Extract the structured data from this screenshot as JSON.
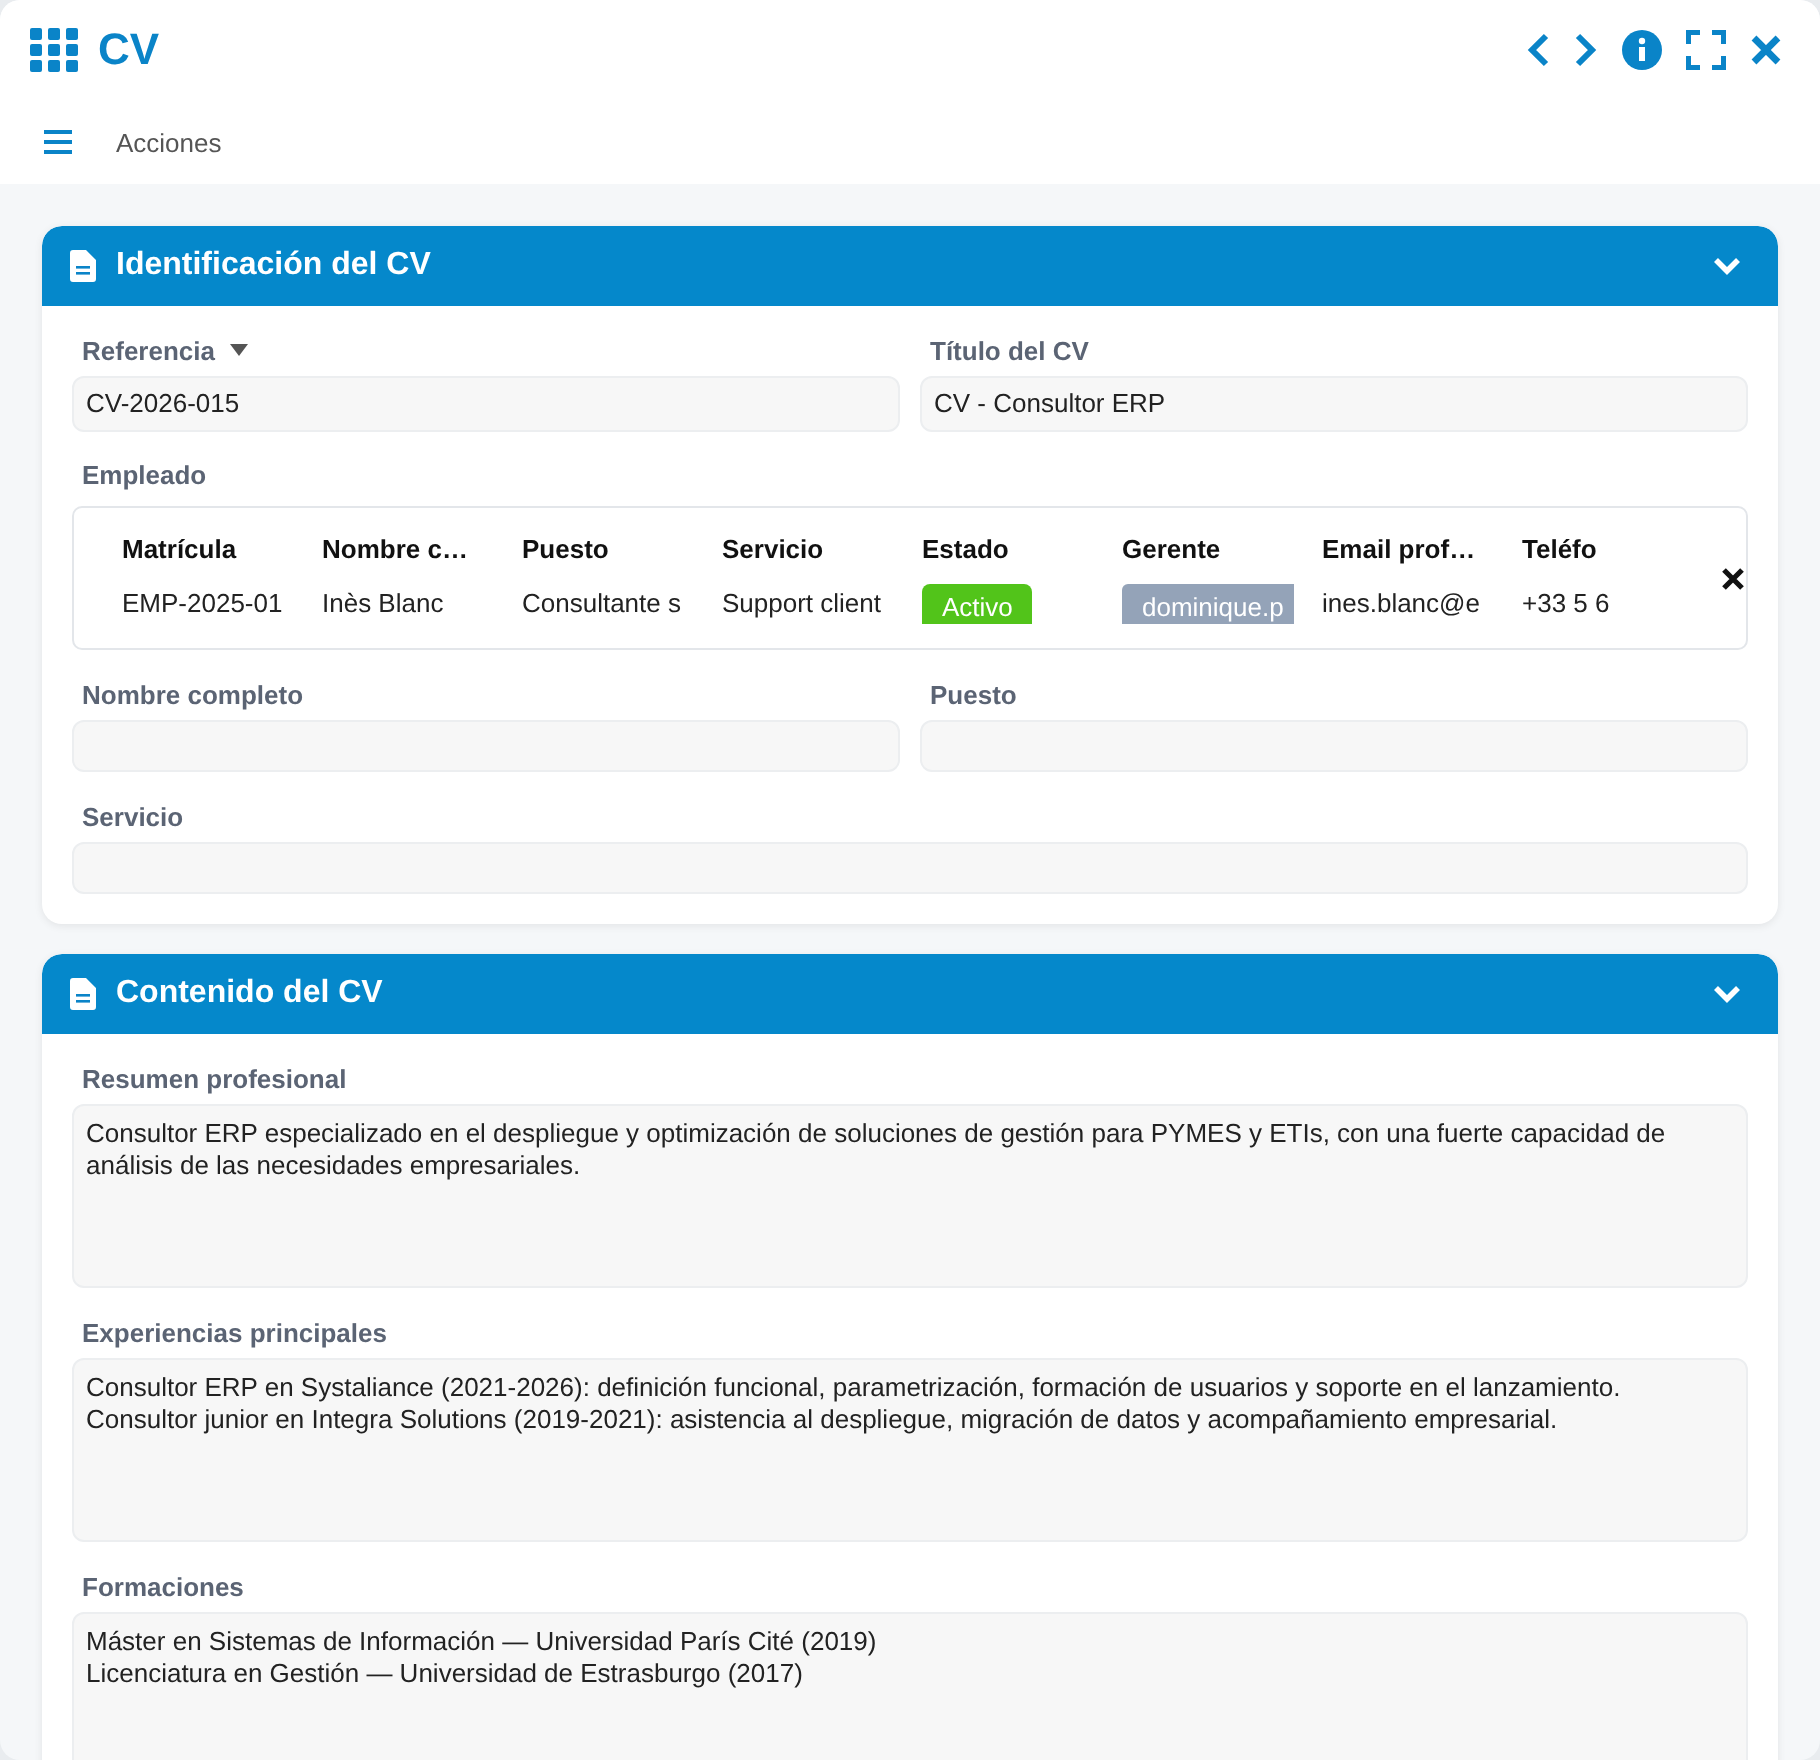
{
  "window": {
    "title": "CV"
  },
  "toolbar": {
    "actions_label": "Acciones"
  },
  "sections": [
    {
      "title": "Identificación del CV",
      "expanded": true,
      "kind": "identification",
      "fields_top": [
        {
          "label": "Referencia",
          "value": "CV-2026-015",
          "dropdown": true
        },
        {
          "label": "Título del CV",
          "value": "CV - Consultor ERP",
          "dropdown": false
        }
      ],
      "employee": {
        "label": "Empleado",
        "columns": [
          {
            "header": "Matrícula",
            "value": "EMP-2025-01",
            "kind": "text"
          },
          {
            "header": "Nombre c…",
            "value": "Inès Blanc",
            "kind": "text"
          },
          {
            "header": "Puesto",
            "value": "Consultante s",
            "kind": "text"
          },
          {
            "header": "Servicio",
            "value": "Support client",
            "kind": "text"
          },
          {
            "header": "Estado",
            "value": "Activo",
            "kind": "status",
            "color": "#52c41a"
          },
          {
            "header": "Gerente",
            "value": "dominique.p",
            "kind": "tag",
            "color": "#94a3b8"
          },
          {
            "header": "Email prof…",
            "value": "ines.blanc@e",
            "kind": "text"
          },
          {
            "header": "Teléfo",
            "value": "+33 5 6",
            "kind": "text"
          }
        ]
      },
      "fields_bottom": [
        {
          "label": "Nombre completo"
        },
        {
          "label": "Puesto"
        },
        {
          "label": "Servicio"
        }
      ]
    },
    {
      "title": "Contenido del CV",
      "expanded": true,
      "kind": "content",
      "areas": [
        {
          "label": "Resumen profesional",
          "value": "Consultor ERP especializado en el despliegue y optimización de soluciones de gestión para PYMES y ETIs, con una fuerte capacidad de análisis de las necesidades empresariales."
        },
        {
          "label": "Experiencias principales",
          "value": "Consultor ERP en Systaliance (2021-2026): definición funcional, parametrización, formación de usuarios y soporte en el lanzamiento.\nConsultor junior en Integra Solutions (2019-2021): asistencia al despliegue, migración de datos y acompañamiento empresarial."
        },
        {
          "label": "Formaciones",
          "value": "Máster en Sistemas de Información — Universidad París Cité (2019)\nLicenciatura en Gestión — Universidad de Estrasburgo (2017)"
        }
      ]
    }
  ]
}
